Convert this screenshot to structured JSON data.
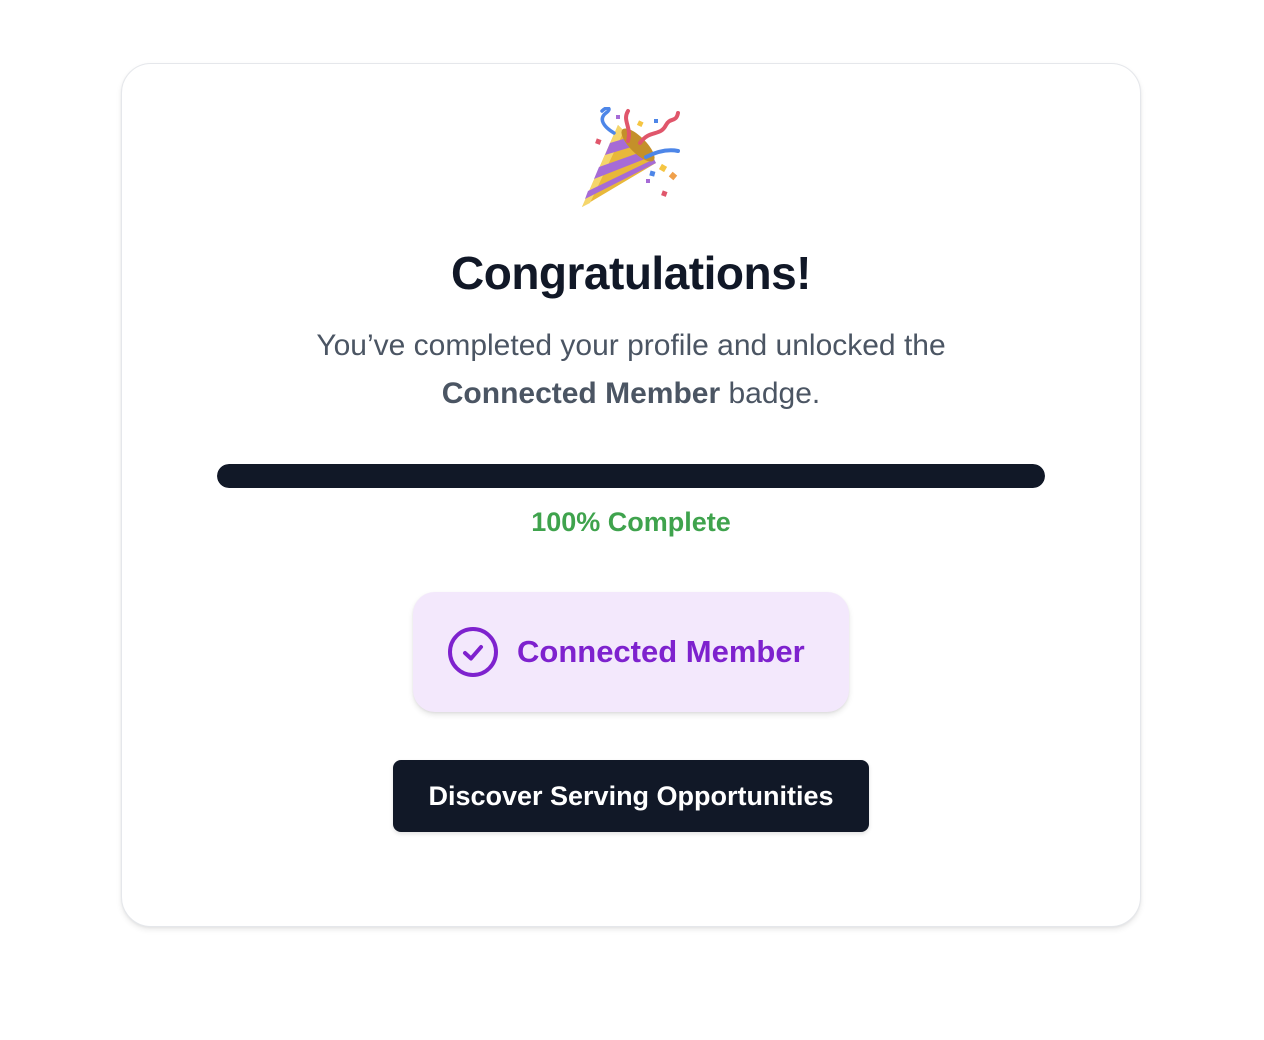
{
  "celebration": {
    "icon": "party-popper-icon",
    "title": "Congratulations!",
    "message_prefix": "You’ve completed your profile and unlocked the",
    "message_badge_name": "Connected Member",
    "message_suffix": " badge."
  },
  "progress": {
    "percent": 100,
    "label": "100% Complete",
    "fill_color": "#111827",
    "label_color": "#3fa34d"
  },
  "badge": {
    "icon": "check-circle-icon",
    "label": "Connected Member",
    "background_color": "#f3e8fc",
    "accent_color": "#7e22ce"
  },
  "cta": {
    "label": "Discover Serving Opportunities",
    "background_color": "#111827"
  }
}
